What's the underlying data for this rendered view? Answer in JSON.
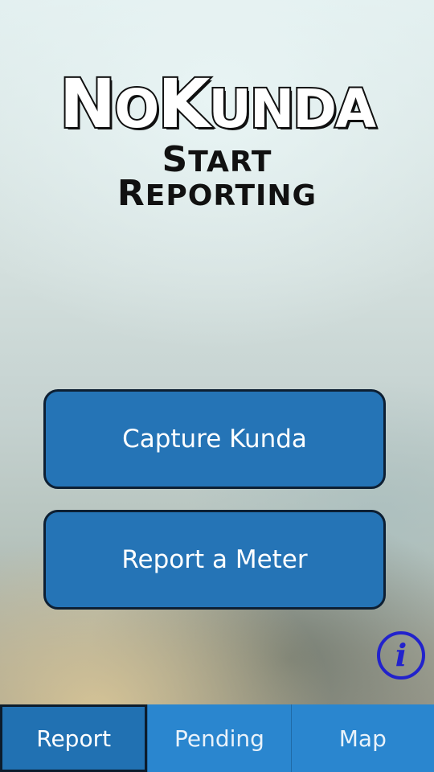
{
  "app": {
    "title_parts": [
      "N",
      "O",
      "K",
      "UNDA"
    ],
    "subtitle_line1_parts": [
      "S",
      "TART"
    ],
    "subtitle_line2_parts": [
      "R",
      "EPORTING"
    ]
  },
  "actions": {
    "capture_label": "Capture Kunda",
    "meter_label": "Report a Meter"
  },
  "info": {
    "icon": "info-icon",
    "glyph": "i"
  },
  "tabs": [
    {
      "label": "Report",
      "active": true
    },
    {
      "label": "Pending",
      "active": false
    },
    {
      "label": "Map",
      "active": false
    }
  ],
  "colors": {
    "button_blue": "#2574b6",
    "tabbar_blue": "#2a86cf",
    "active_tab_blue": "#2171b2",
    "info_icon_blue": "#2222cc"
  }
}
